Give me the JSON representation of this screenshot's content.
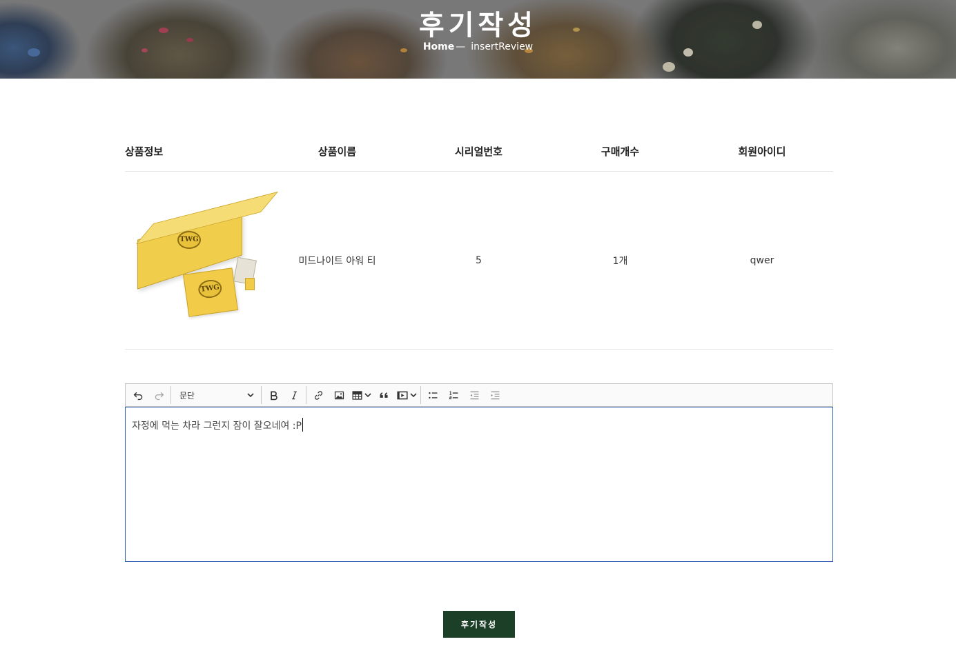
{
  "hero": {
    "title": "후기작성",
    "breadcrumb_home": "Home",
    "breadcrumb_sep": "—",
    "breadcrumb_current": "insertReview"
  },
  "table": {
    "headers": [
      "상품정보",
      "상품이름",
      "시리얼번호",
      "구매개수",
      "회원아이디"
    ],
    "row": {
      "image_label": "TWG",
      "product_name": "미드나이트 아워 티",
      "serial": "5",
      "quantity": "1개",
      "member_id": "qwer"
    }
  },
  "editor": {
    "heading_select": "문단",
    "content": "자정에 먹는 차라 그런지 잠이 잘오네여 :P",
    "toolbar_icons": [
      "undo-icon",
      "redo-icon",
      "bold-icon",
      "italic-icon",
      "link-icon",
      "image-icon",
      "table-icon",
      "quote-icon",
      "media-icon",
      "bulleted-list-icon",
      "numbered-list-icon",
      "outdent-icon",
      "indent-icon"
    ]
  },
  "submit_label": "후기작성",
  "colors": {
    "submit_bg": "#1c3f27",
    "editor_focus_border": "#2d5fae"
  }
}
